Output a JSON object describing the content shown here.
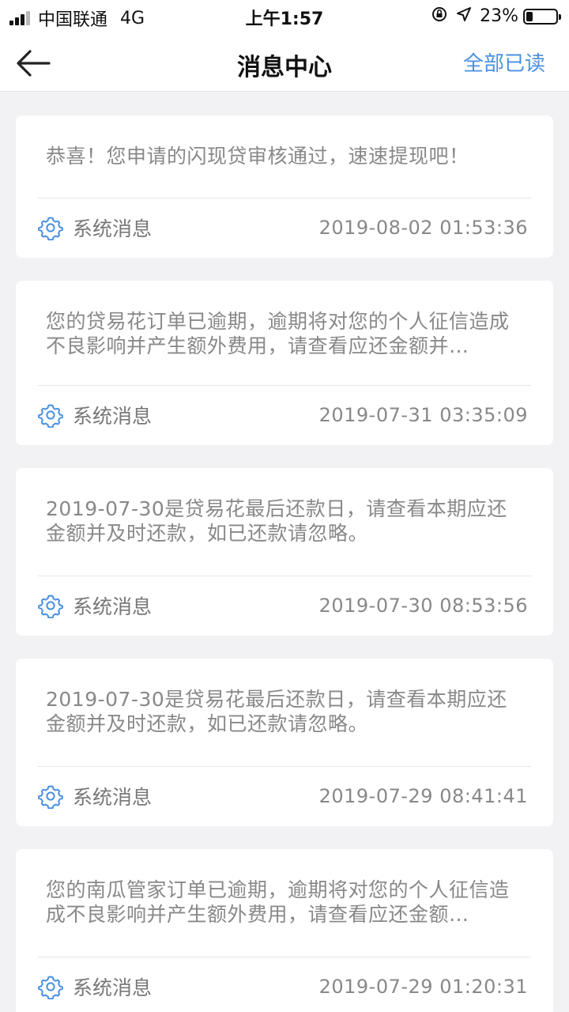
{
  "status_bar": {
    "carrier": "中国联通",
    "network": "4G",
    "time": "上午1:57",
    "battery_percent_label": "23%",
    "battery_level": 0.23,
    "icons": [
      "orientation-lock-icon",
      "location-arrow-icon"
    ]
  },
  "nav": {
    "back_icon": "arrow-left-icon",
    "title": "消息中心",
    "read_all_label": "全部已读"
  },
  "colors": {
    "accent": "#4a90e2",
    "background": "#f2f2f4",
    "card": "#ffffff",
    "body_text": "#888888"
  },
  "messages": [
    {
      "text": "恭喜！您申请的闪现贷审核通过，速速提现吧！",
      "sender": "系统消息",
      "time": "2019-08-02 01:53:36",
      "icon": "gear-icon"
    },
    {
      "text": "您的贷易花订单已逾期，逾期将对您的个人征信造成不良影响并产生额外费用，请查看应还金额并…",
      "sender": "系统消息",
      "time": "2019-07-31 03:35:09",
      "icon": "gear-icon"
    },
    {
      "text": "2019-07-30是贷易花最后还款日，请查看本期应还金额并及时还款，如已还款请忽略。",
      "sender": "系统消息",
      "time": "2019-07-30 08:53:56",
      "icon": "gear-icon"
    },
    {
      "text": "2019-07-30是贷易花最后还款日，请查看本期应还金额并及时还款，如已还款请忽略。",
      "sender": "系统消息",
      "time": "2019-07-29 08:41:41",
      "icon": "gear-icon"
    },
    {
      "text": "您的南瓜管家订单已逾期，逾期将对您的个人征信造成不良影响并产生额外费用，请查看应还金额…",
      "sender": "系统消息",
      "time": "2019-07-29 01:20:31",
      "icon": "gear-icon"
    }
  ]
}
